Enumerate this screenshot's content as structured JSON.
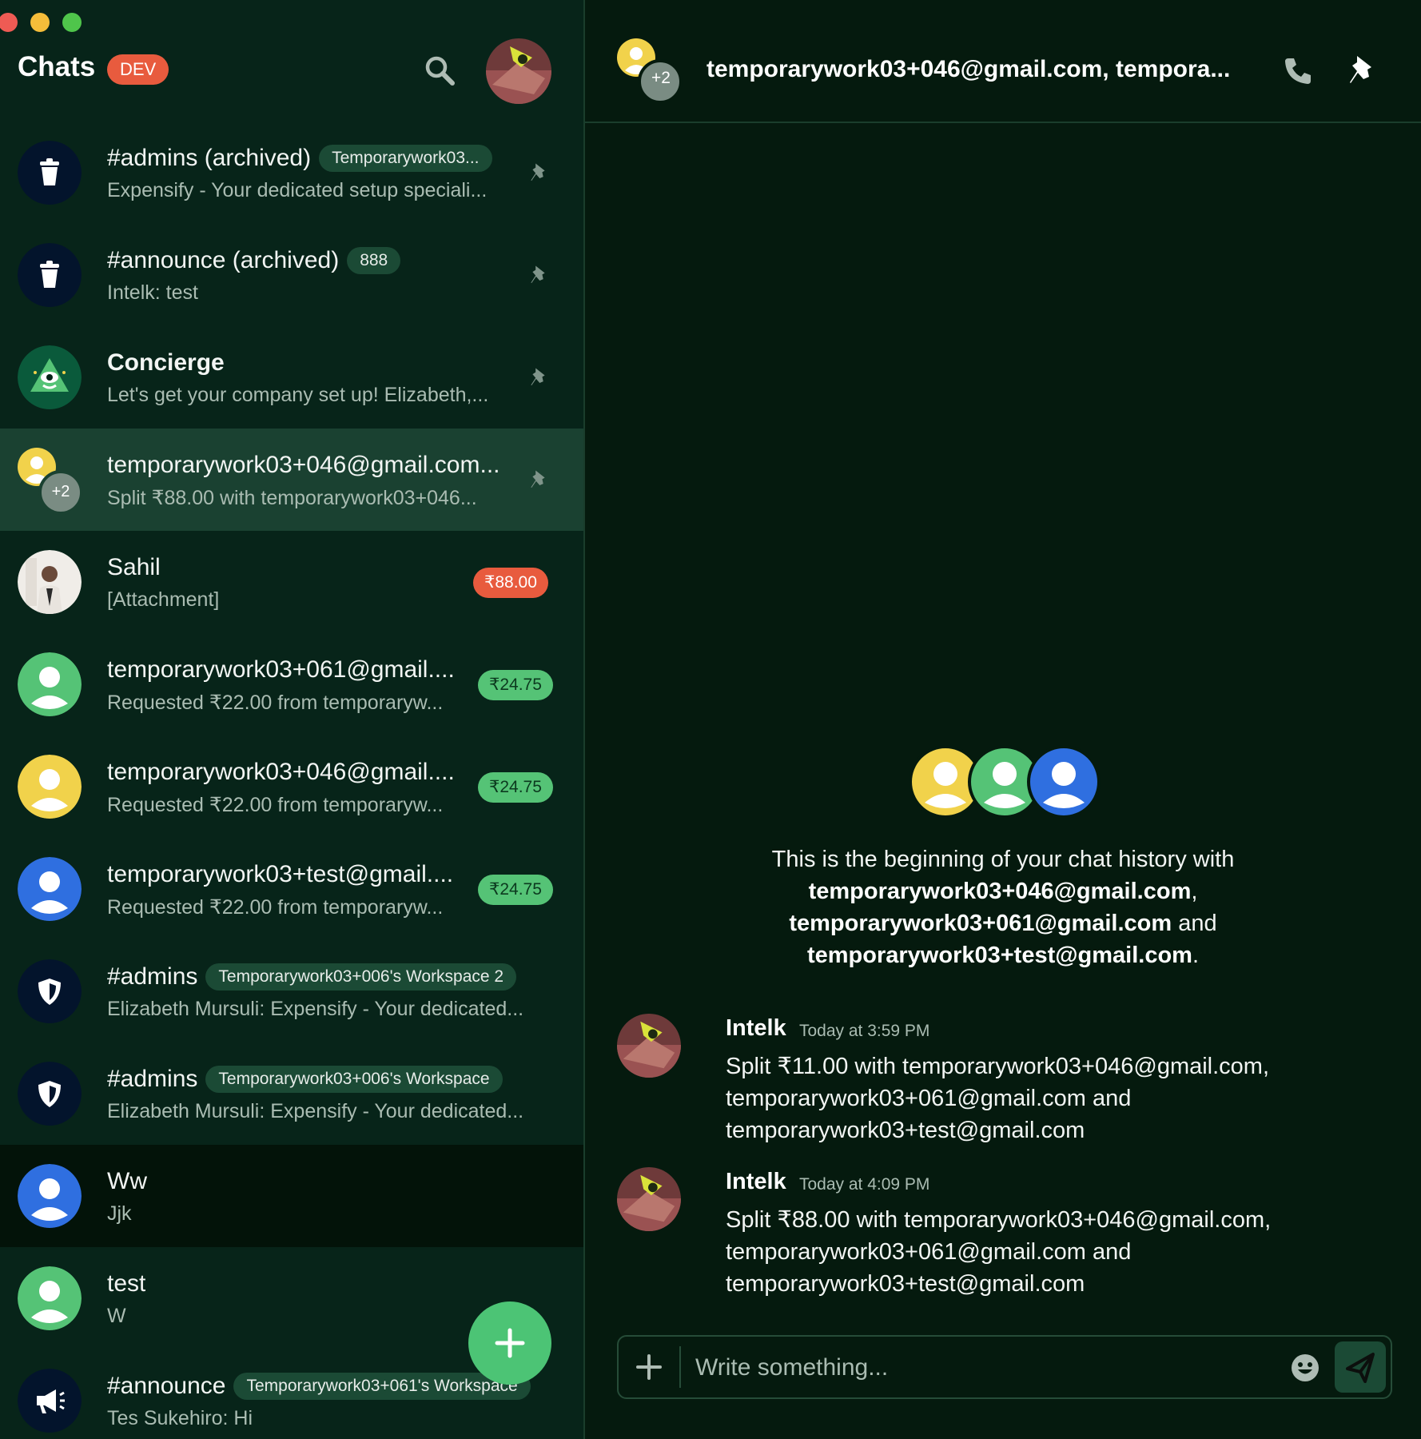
{
  "sidebar": {
    "title": "Chats",
    "env_badge": "DEV",
    "rows": [
      {
        "title": "#admins (archived)",
        "tag": "Temporarywork03...",
        "subtitle": "Expensify - Your dedicated setup speciali...",
        "avatar": "trash-icon",
        "pinned": true
      },
      {
        "title": "#announce (archived)",
        "tag": "888",
        "subtitle": "Intelk: test",
        "avatar": "trash-icon",
        "pinned": true
      },
      {
        "title": "Concierge",
        "subtitle": "Let's get your company set up! Elizabeth,...",
        "avatar": "concierge-logo",
        "pinned": true
      },
      {
        "title": "temporarywork03+046@gmail.com...",
        "subtitle": "Split ₹88.00 with temporarywork03+046...",
        "avatar": "group-avatar",
        "avatar_count": "+2",
        "pinned": true,
        "active": true
      },
      {
        "title": "Sahil",
        "subtitle": "[Attachment]",
        "avatar": "person-photo",
        "amount": "₹88.00",
        "amount_color": "#e85b3e"
      },
      {
        "title": "temporarywork03+061@gmail....",
        "subtitle": "Requested ₹22.00 from temporaryw...",
        "avatar": "default-user-green",
        "amount": "₹24.75",
        "amount_color": "#55c376"
      },
      {
        "title": "temporarywork03+046@gmail....",
        "subtitle": "Requested ₹22.00 from temporaryw...",
        "avatar": "default-user-yellow",
        "amount": "₹24.75",
        "amount_color": "#55c376"
      },
      {
        "title": "temporarywork03+test@gmail....",
        "subtitle": "Requested ₹22.00 from temporaryw...",
        "avatar": "default-user-blue",
        "amount": "₹24.75",
        "amount_color": "#55c376"
      },
      {
        "title": "#admins",
        "tag": "Temporarywork03+006's Workspace 2",
        "subtitle": "Elizabeth Mursuli: Expensify - Your dedicated...",
        "avatar": "shield-icon"
      },
      {
        "title": "#admins",
        "tag": "Temporarywork03+006's Workspace",
        "subtitle": "Elizabeth Mursuli: Expensify - Your dedicated...",
        "avatar": "shield-icon"
      },
      {
        "title": "Ww",
        "subtitle": "Jjk",
        "avatar": "default-user-blue",
        "unread": true
      },
      {
        "title": "test",
        "subtitle": "W",
        "avatar": "default-user-green"
      },
      {
        "title": "#announce",
        "tag": "Temporarywork03+061's Workspace",
        "subtitle": "Tes Sukehiro: Hi",
        "avatar": "megaphone-icon"
      }
    ]
  },
  "header": {
    "title": "temporarywork03+046@gmail.com, tempora...",
    "avatar_count": "+2"
  },
  "intro": {
    "lead": "This is the beginning of your chat history with",
    "p1": "temporarywork03+046@gmail.com",
    "sep1": ",",
    "p2": "temporarywork03+061@gmail.com",
    "sep2": " and",
    "p3": "temporarywork03+test@gmail.com",
    "end": "."
  },
  "messages": [
    {
      "author": "Intelk",
      "time": "Today at 3:59 PM",
      "text": "Split ₹11.00 with temporarywork03+046@gmail.com, temporarywork03+061@gmail.com and temporarywork03+test@gmail.com"
    },
    {
      "author": "Intelk",
      "time": "Today at 4:09 PM",
      "text": "Split ₹88.00 with temporarywork03+046@gmail.com, temporarywork03+061@gmail.com and temporarywork03+test@gmail.com"
    }
  ],
  "composer": {
    "placeholder": "Write something..."
  },
  "colors": {
    "bg": "#061b0f",
    "sidebar": "#072419",
    "accent": "#4cc475",
    "badge_red": "#e85b3e",
    "user_yellow": "#f1d24b",
    "user_green": "#55c376",
    "user_blue": "#2f6fe0"
  }
}
